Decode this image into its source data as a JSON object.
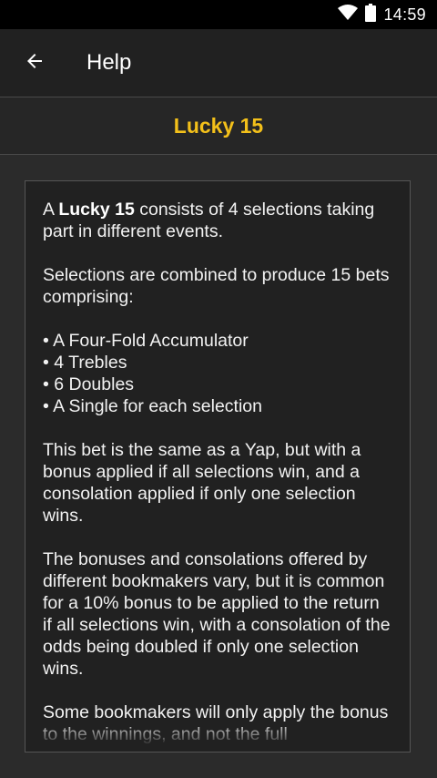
{
  "status_bar": {
    "time": "14:59",
    "icons": [
      "wifi-icon",
      "battery-icon"
    ]
  },
  "app_bar": {
    "back_icon": "arrow-left-icon",
    "title": "Help"
  },
  "section": {
    "title": "Lucky 15"
  },
  "article": {
    "p1_prefix": "A ",
    "p1_bold": "Lucky 15",
    "p1_suffix": " consists of 4 selections taking part in different events.",
    "p2": "Selections are combined to produce 15 bets comprising:",
    "bullets": [
      "• A Four-Fold Accumulator",
      "• 4 Trebles",
      "• 6 Doubles",
      "• A Single for each selection"
    ],
    "p3": "This bet is the same as a Yap, but with a bonus applied if all selections win, and a consolation applied if only one selection wins.",
    "p4": "The bonuses and consolations offered by different bookmakers vary, but it is common for a 10% bonus to be applied to the return if all selections win, with a consolation of the odds being doubled if only one selection wins.",
    "p5": "Some bookmakers will only apply the bonus to the winnings, and not the full"
  },
  "colors": {
    "accent": "#f3c01a",
    "background": "#2b2b2b",
    "app_bar": "#212121",
    "text": "#f2f2f2"
  }
}
